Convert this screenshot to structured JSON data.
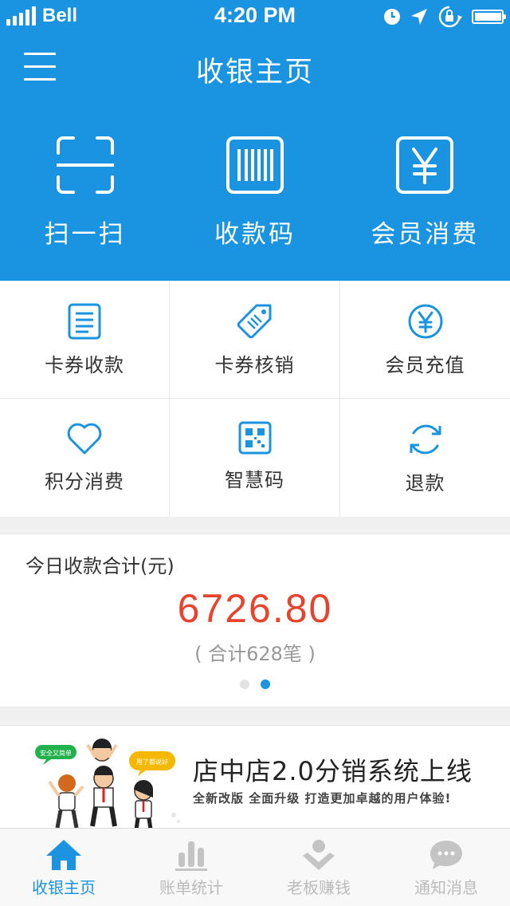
{
  "status_bar": {
    "carrier": "Bell",
    "time": "4:20 PM"
  },
  "header": {
    "title": "收银主页"
  },
  "quick_actions": [
    {
      "label": "扫一扫",
      "icon": "scan-icon"
    },
    {
      "label": "收款码",
      "icon": "barcode-icon"
    },
    {
      "label": "会员消费",
      "icon": "yen-icon"
    }
  ],
  "grid": [
    {
      "label": "卡券收款",
      "icon": "document-icon"
    },
    {
      "label": "卡券核销",
      "icon": "tag-icon"
    },
    {
      "label": "会员充值",
      "icon": "yen-circle-icon"
    },
    {
      "label": "积分消费",
      "icon": "heart-icon"
    },
    {
      "label": "智慧码",
      "icon": "qrcode-icon"
    },
    {
      "label": "退款",
      "icon": "refresh-icon"
    }
  ],
  "summary": {
    "title": "今日收款合计(元)",
    "amount": "6726.80",
    "count": "( 合计628笔 )",
    "page_index": 2,
    "page_total": 2
  },
  "banner": {
    "title": "店中店2.0分销系统上线",
    "subtitle": "全新改版 全面升级 打造更加卓越的用户体验!",
    "bubble_left": "安全又简单",
    "bubble_right": "用了都说好"
  },
  "tabbar": [
    {
      "label": "收银主页",
      "icon": "home-icon",
      "active": true
    },
    {
      "label": "账单统计",
      "icon": "bar-chart-icon",
      "active": false
    },
    {
      "label": "老板赚钱",
      "icon": "earn-icon",
      "active": false
    },
    {
      "label": "通知消息",
      "icon": "message-icon",
      "active": false
    }
  ],
  "colors": {
    "primary": "#1a93e0",
    "amount": "#e8432d",
    "inactive_tab": "#bbbbbb"
  }
}
